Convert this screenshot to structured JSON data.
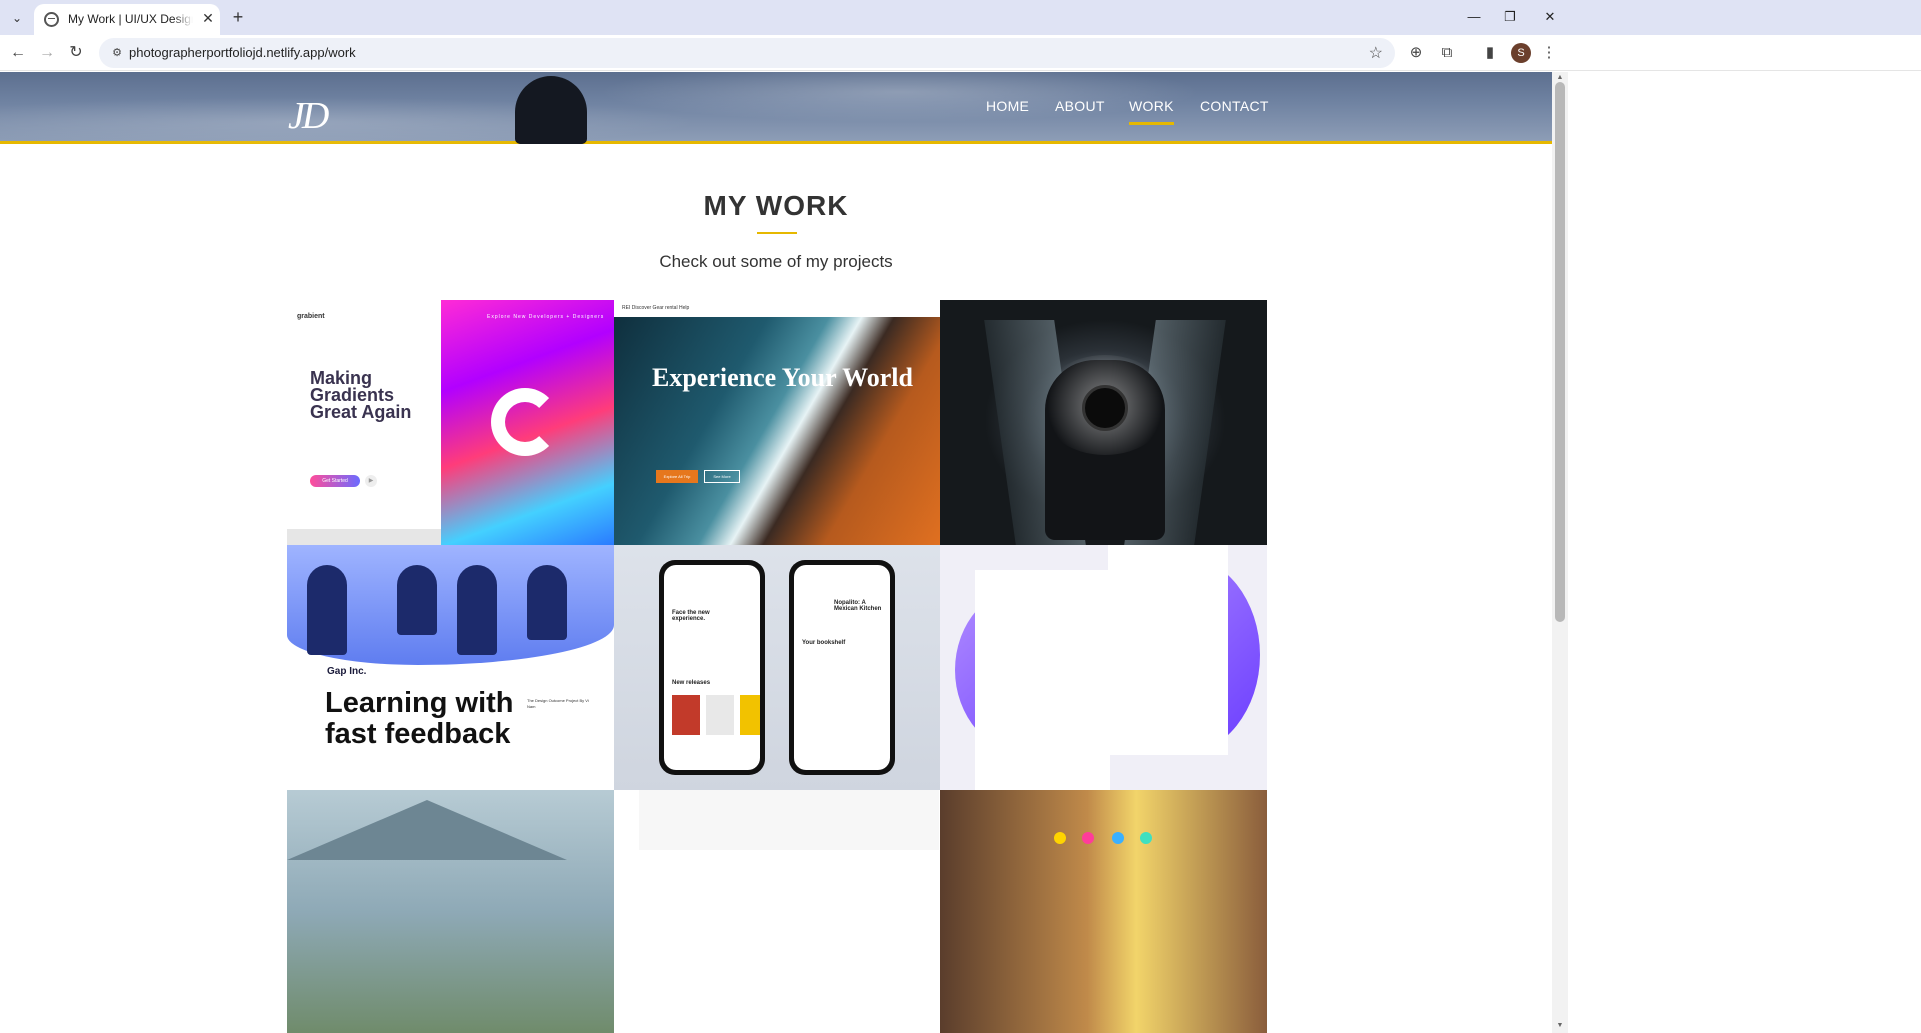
{
  "browser": {
    "tab_title": "My Work | UI/UX Designer & Photographer",
    "url": "photographerportfoliojd.netlify.app/work",
    "profile_initial": "S"
  },
  "site": {
    "logo": "JD",
    "nav": [
      {
        "label": "HOME",
        "active": false
      },
      {
        "label": "ABOUT",
        "active": false
      },
      {
        "label": "WORK",
        "active": true
      },
      {
        "label": "CONTACT",
        "active": false
      }
    ],
    "accent_color": "#e6b800"
  },
  "section": {
    "title": "MY WORK",
    "subtitle": "Check out some of my projects"
  },
  "projects": {
    "gradient": {
      "brand": "grabient",
      "headline": "Making Gradients Great Again",
      "cta": "Get Started",
      "menu": "Explore   New   Developers   + Designers"
    },
    "travel": {
      "nav": "REI   Discover   Gear rental   Help",
      "headline": "Experience Your World",
      "cta": "Explore All Trip",
      "cta2": "See More"
    },
    "gap": {
      "brand": "Gap Inc.",
      "headline": "Learning with fast feedback",
      "side": "The Design Outcome Project By Vi Nam"
    },
    "books": {
      "phone1_head": "Face the new experience.",
      "phone1_sub": "New releases",
      "phone2_head": "Nopalito: A Mexican Kitchen",
      "phone2_sub": "Your bookshelf"
    }
  }
}
